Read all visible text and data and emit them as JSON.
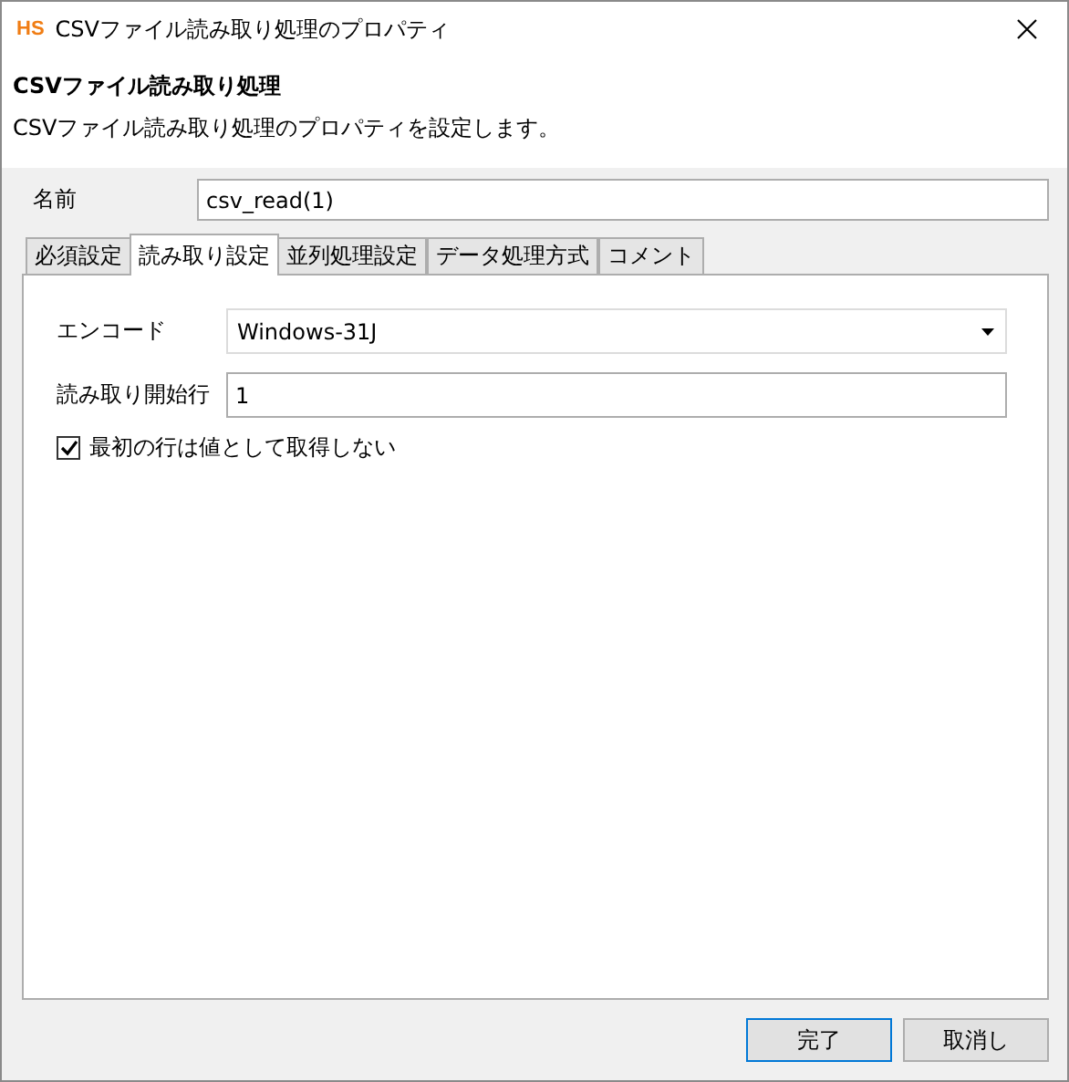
{
  "window": {
    "logo": "HS",
    "title": "CSVファイル読み取り処理のプロパティ"
  },
  "header": {
    "title": "CSVファイル読み取り処理",
    "description": "CSVファイル読み取り処理のプロパティを設定します。"
  },
  "name_field": {
    "label": "名前",
    "value": "csv_read(1)"
  },
  "tabs": [
    {
      "label": "必須設定",
      "selected": false
    },
    {
      "label": "読み取り設定",
      "selected": true
    },
    {
      "label": "並列処理設定",
      "selected": false
    },
    {
      "label": "データ処理方式",
      "selected": false
    },
    {
      "label": "コメント",
      "selected": false
    }
  ],
  "fields": [
    {
      "kind": "dropdown",
      "label": "エンコード",
      "value": "Windows-31J"
    },
    {
      "kind": "text",
      "label": "読み取り開始行",
      "value": "1"
    }
  ],
  "checkbox": {
    "label": "最初の行は値として取得しない",
    "checked": true
  },
  "buttons": [
    {
      "label": "完了",
      "default": true
    },
    {
      "label": "取消し",
      "default": false
    }
  ]
}
